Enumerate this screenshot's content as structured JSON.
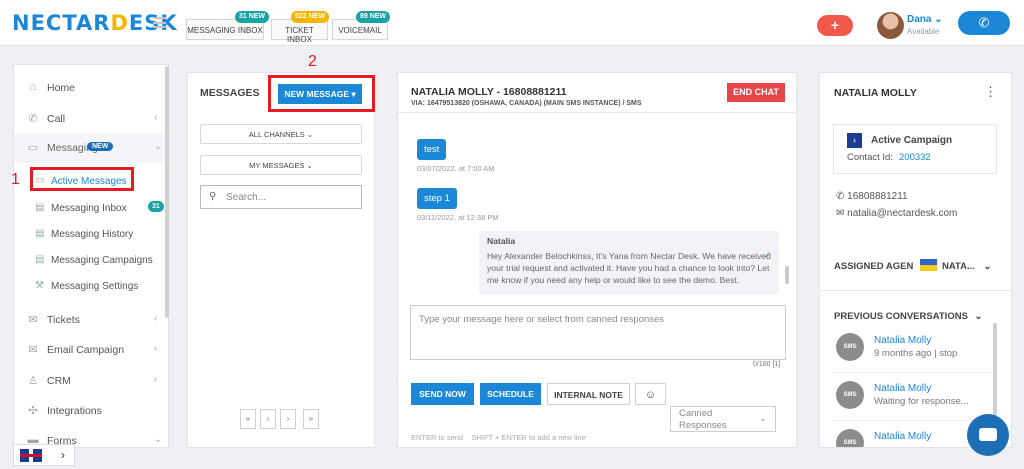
{
  "header": {
    "logo": "NECTARDESK",
    "inbox_buttons": [
      {
        "label": "MESSAGING INBOX",
        "badge": "31 NEW"
      },
      {
        "label": "TICKET INBOX",
        "badge": "522 NEW"
      },
      {
        "label": "VOICEMAIL",
        "badge": "89 NEW"
      }
    ],
    "plus": "+",
    "user": {
      "name": "Dana",
      "status": "Available"
    },
    "phone_icon": "phone-icon"
  },
  "sidebar": {
    "items": [
      {
        "label": "Home",
        "icon": "home-icon"
      },
      {
        "label": "Call",
        "icon": "phone-icon"
      },
      {
        "label": "Messaging",
        "icon": "chat-icon",
        "badge": "NEW"
      },
      {
        "label": "Tickets",
        "icon": "ticket-icon"
      },
      {
        "label": "Email Campaign",
        "icon": "mail-icon"
      },
      {
        "label": "CRM",
        "icon": "user-icon"
      },
      {
        "label": "Integrations",
        "icon": "puzzle-icon"
      },
      {
        "label": "Forms",
        "icon": "folder-icon"
      }
    ],
    "sub_items": [
      {
        "label": "Active Messages"
      },
      {
        "label": "Messaging Inbox",
        "count": "31"
      },
      {
        "label": "Messaging History"
      },
      {
        "label": "Messaging Campaigns"
      },
      {
        "label": "Messaging Settings"
      }
    ]
  },
  "annotations": {
    "one": "1",
    "two": "2"
  },
  "messages": {
    "title": "MESSAGES",
    "new_message": "NEW MESSAGE",
    "all_channels": "ALL CHANNELS",
    "my_messages": "MY MESSAGES",
    "search_placeholder": "Search...",
    "pager": [
      "«",
      "‹",
      "›",
      "»"
    ]
  },
  "chat": {
    "title": "NATALIA MOLLY - 16808881211",
    "via": "VIA: 16479513820 (OSHAWA, CANADA) (MAIN SMS INSTANCE) / SMS",
    "end_chat": "END CHAT",
    "messages": [
      {
        "text": "test",
        "time": "03/07/2022, at 7:00 AM"
      },
      {
        "text": "step 1",
        "time": "03/11/2022, at 12:38 PM"
      }
    ],
    "outgoing": {
      "sender": "Natalia",
      "text": "Hey Alexander Belochkinss, It's Yana from Nectar Desk. We have received your trial request and activated it. Have you had a chance to look into? Let me know if you need any help or would like to see the demo. Best."
    },
    "input_placeholder": "Type your message here or select from canned responses",
    "char_count": "0/160 [1]",
    "buttons": {
      "send": "SEND NOW",
      "schedule": "SCHEDULE",
      "note": "INTERNAL NOTE",
      "emoji": "☺"
    },
    "canned": "Canned Responses",
    "hint": "ENTER to send    SHIFT + ENTER to add a new line"
  },
  "contact": {
    "name": "NATALIA MOLLY",
    "integration": "Active Campaign",
    "contact_id_label": "Contact Id:",
    "contact_id": "200332",
    "phone": "16808881211",
    "email": "natalia@nectardesk.com",
    "assigned_label": "ASSIGNED AGEN",
    "assigned_value": "NATA...",
    "previous_label": "PREVIOUS CONVERSATIONS",
    "conversations": [
      {
        "name": "Natalia Molly",
        "detail": "9 months ago | stop",
        "icon": "SMS"
      },
      {
        "name": "Natalia Molly",
        "detail": "Waiting for response...",
        "icon": "SMS"
      },
      {
        "name": "Natalia Molly",
        "detail": "",
        "icon": "SMS"
      }
    ]
  },
  "colors": {
    "brand": "#1c87d6",
    "accent": "#f2b600",
    "danger": "#e44747",
    "annotation": "#e51b23"
  }
}
